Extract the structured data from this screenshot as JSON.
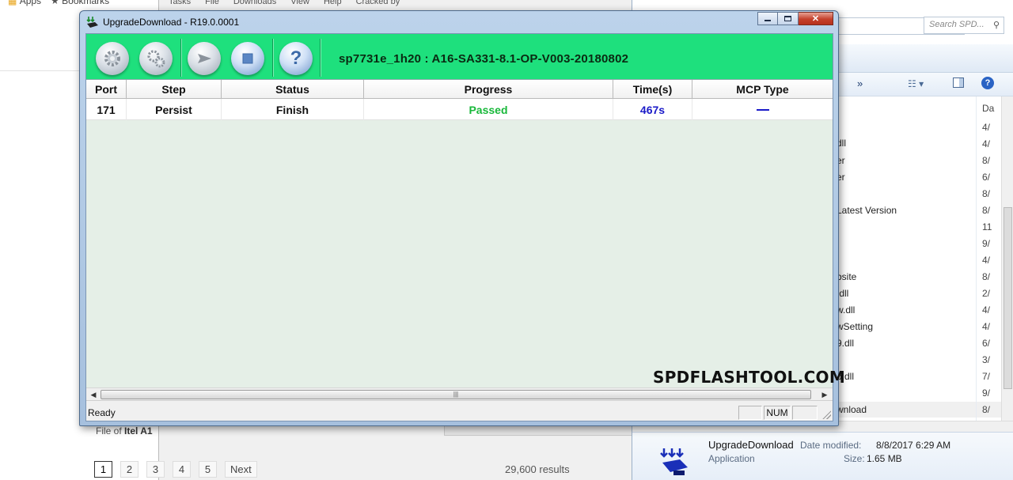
{
  "browser": {
    "bookmarks_apps": "Apps",
    "bookmarks_label": "Bookmarks",
    "caption_prefix": "File of",
    "caption_bold": "Itel A1",
    "pages": [
      "1",
      "2",
      "3",
      "4",
      "5"
    ],
    "next_label": "Next",
    "results_text": "29,600 results"
  },
  "bg_app": {
    "menu": [
      "Tasks",
      "File",
      "Downloads",
      "View",
      "Help",
      "Cracked by"
    ]
  },
  "explorer": {
    "search_placeholder": "Search SPD...",
    "file_names": [
      "dll",
      "er",
      "er",
      "Latest Version",
      "bsite",
      ".dll",
      "w.dll",
      "wSetting",
      "9.dll",
      "p.dll",
      "wnload"
    ],
    "date_header": "Da",
    "dates": [
      "4/",
      "4/",
      "8/",
      "6/",
      "8/",
      "8/",
      "11",
      "9/",
      "4/",
      "8/",
      "2/",
      "4/",
      "4/",
      "6/",
      "3/",
      "7/",
      "9/",
      "8/"
    ],
    "details": {
      "name": "UpgradeDownload",
      "type": "Application",
      "modified_label": "Date modified:",
      "modified_value": "8/8/2017 6:29 AM",
      "size_label": "Size:",
      "size_value": "1.65 MB"
    }
  },
  "window": {
    "title": "UpgradeDownload - R19.0.0001",
    "firmware_label": "sp7731e_1h20 : A16-SA331-8.1-OP-V003-20180802",
    "toolbar_icons": [
      "gear-icon",
      "gears-icon",
      "play-icon",
      "stop-icon",
      "help-icon"
    ],
    "columns": [
      "Port",
      "Step",
      "Status",
      "Progress",
      "Time(s)",
      "MCP Type"
    ],
    "rows": [
      {
        "port": "171",
        "step": "Persist",
        "status": "Finish",
        "progress": "Passed",
        "time": "467s",
        "mcp": ""
      }
    ],
    "watermark": "SPDFLASHTOOL.COM",
    "status_text": "Ready",
    "status_panes": [
      "",
      "NUM",
      ""
    ]
  },
  "colors": {
    "toolbar_bg": "#1ee07d",
    "passed": "#18b83a",
    "time": "#1a1ac8",
    "grid_bg": "#e5efe7"
  }
}
